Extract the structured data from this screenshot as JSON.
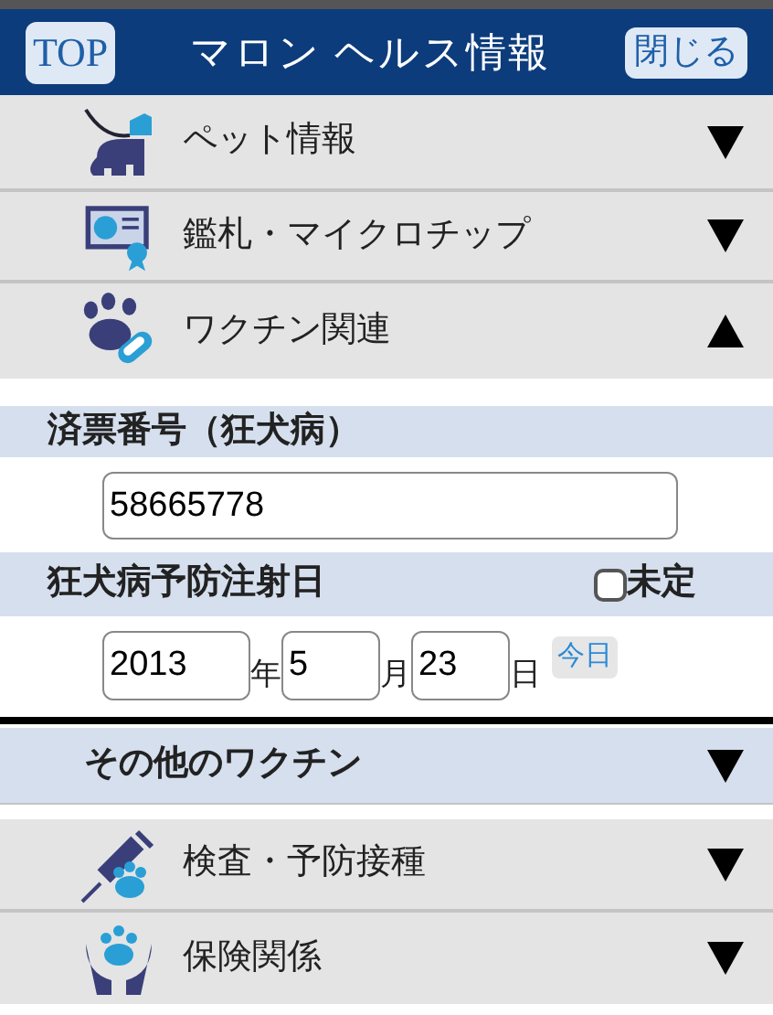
{
  "header": {
    "top_button": "TOP",
    "title": "マロン ヘルス情報",
    "close_button": "閉じる"
  },
  "menu": [
    {
      "label": "ペット情報",
      "expanded": false
    },
    {
      "label": "鑑札・マイクロチップ",
      "expanded": false
    },
    {
      "label": "ワクチン関連",
      "expanded": true
    }
  ],
  "vaccine": {
    "tag_label": "済票番号（狂犬病）",
    "tag_value": "58665778",
    "date_label": "狂犬病予防注射日",
    "undecided": {
      "label": "未定",
      "checked": false
    },
    "date": {
      "year": "2013",
      "year_unit": "年",
      "month": "5",
      "month_unit": "月",
      "day": "23",
      "day_unit": "日",
      "today_button": "今日"
    }
  },
  "other_vaccines": {
    "label": "その他のワクチン",
    "expanded": false
  },
  "menu_2": [
    {
      "label": "検査・予防接種",
      "expanded": false
    },
    {
      "label": "保険関係",
      "expanded": false
    }
  ]
}
